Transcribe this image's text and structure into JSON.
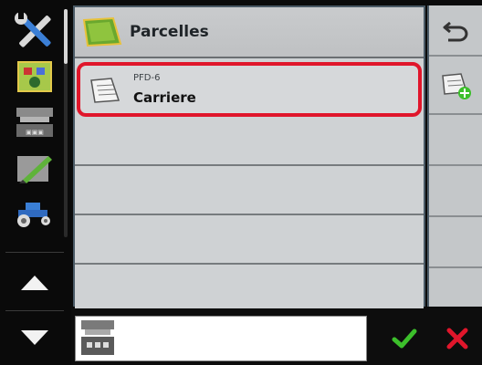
{
  "header": {
    "title": "Parcelles"
  },
  "list": {
    "items": [
      {
        "code": "PFD-6",
        "name": "Carriere",
        "selected": true
      },
      {
        "code": "",
        "name": ""
      },
      {
        "code": "",
        "name": ""
      },
      {
        "code": "",
        "name": ""
      },
      {
        "code": "",
        "name": ""
      }
    ]
  },
  "colors": {
    "selection": "#e0162b",
    "ok": "#3cbf2b",
    "cancel": "#e0162b",
    "panel": "#cfd2d4"
  },
  "icons": {
    "sidebar": [
      "tools-icon",
      "field-map-icon",
      "spreader-icon",
      "field-edit-icon",
      "tractor-icon",
      "arrow-up-icon",
      "arrow-down-icon"
    ],
    "right": [
      "back-icon",
      "add-field-icon"
    ],
    "bottom": [
      "spreader-preview-icon",
      "check-icon",
      "close-icon"
    ]
  }
}
